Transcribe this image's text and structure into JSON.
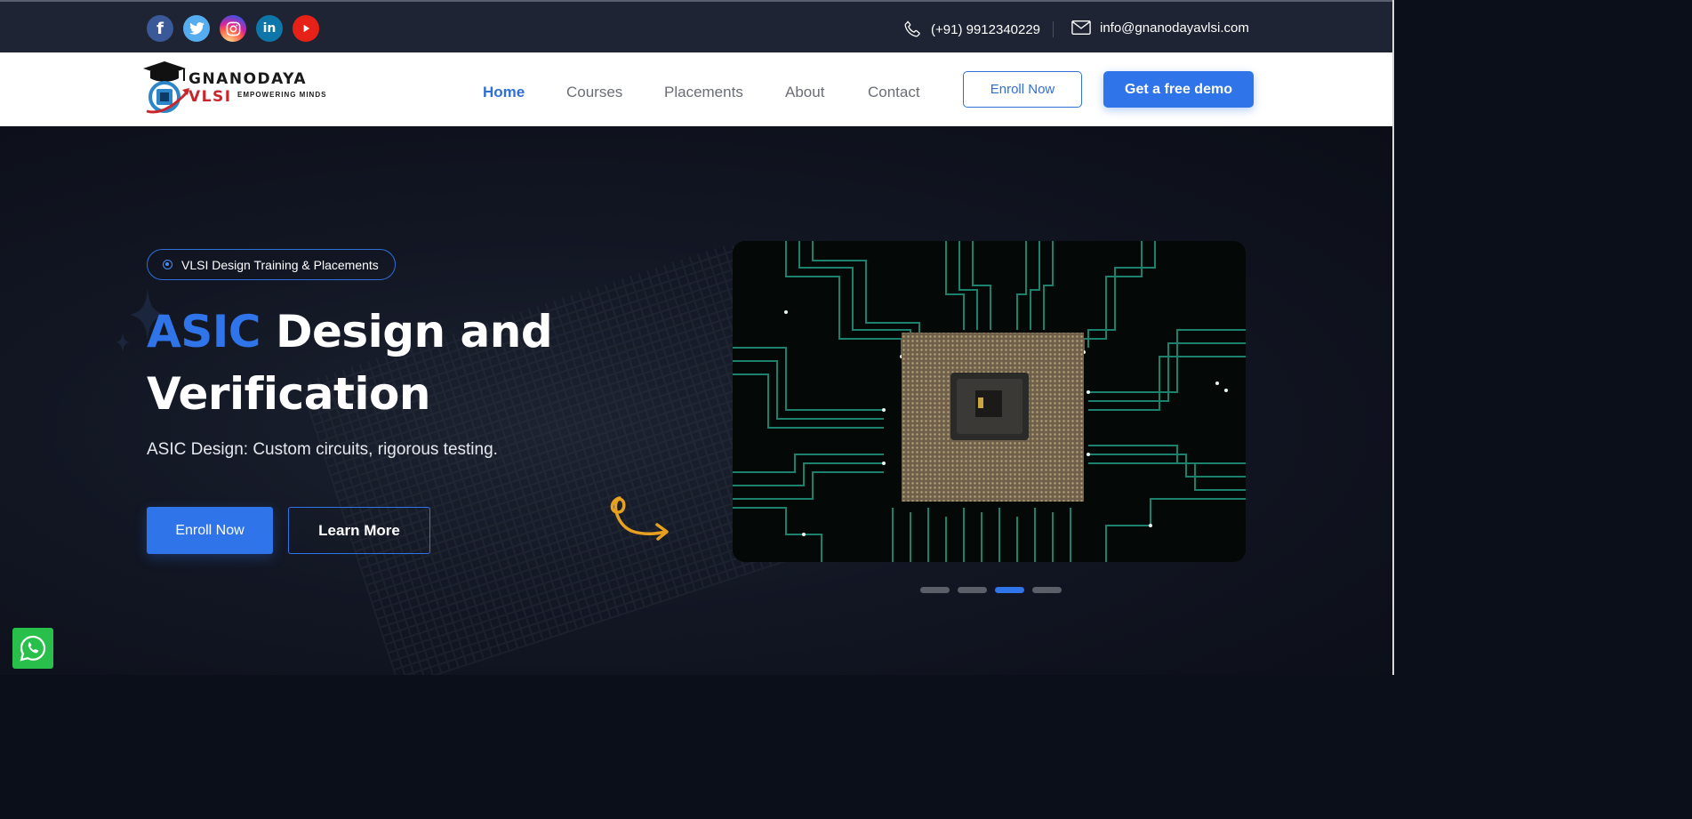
{
  "topbar": {
    "socials": [
      {
        "name": "facebook",
        "icon": "facebook-icon"
      },
      {
        "name": "twitter",
        "icon": "twitter-icon"
      },
      {
        "name": "instagram",
        "icon": "instagram-icon"
      },
      {
        "name": "linkedin",
        "icon": "linkedin-icon"
      },
      {
        "name": "youtube",
        "icon": "youtube-icon"
      }
    ],
    "phone": "(+91) 9912340229",
    "email": "info@gnanodayavlsi.com"
  },
  "brand": {
    "name_part1": "GNANODAYA",
    "name_part2": "VLSI",
    "tagline": "EMPOWERING MINDS"
  },
  "nav": {
    "items": [
      "Home",
      "Courses",
      "Placements",
      "About",
      "Contact"
    ],
    "active": "Home",
    "enroll_label": "Enroll Now",
    "demo_label": "Get a free demo"
  },
  "hero": {
    "badge": "VLSI Design Training & Placements",
    "title_accent": "ASIC",
    "title_rest": "Design and Verification",
    "subtitle": "ASIC Design: Custom circuits, rigorous testing.",
    "primary_button": "Enroll Now",
    "secondary_button": "Learn More",
    "slides_total": 4,
    "active_slide": 3
  },
  "colors": {
    "accent": "#2f74e8",
    "topbar": "#1e2433",
    "whatsapp": "#28c04b",
    "squiggle": "#e8a020"
  }
}
